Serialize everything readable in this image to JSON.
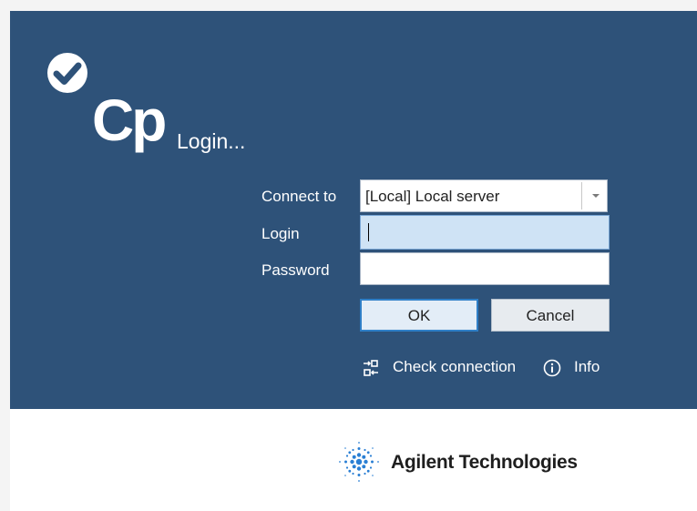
{
  "app": {
    "logo_text": "Cp",
    "title": "Login..."
  },
  "form": {
    "connect_to_label": "Connect to",
    "connect_to_value": "[Local] Local server",
    "login_label": "Login",
    "login_value": "",
    "password_label": "Password",
    "password_value": ""
  },
  "buttons": {
    "ok_label": "OK",
    "cancel_label": "Cancel"
  },
  "links": {
    "check_connection_label": "Check connection",
    "check_connection_icon": "connection-icon",
    "info_label": "Info",
    "info_icon": "info-icon"
  },
  "footer": {
    "brand_name": "Agilent Technologies",
    "brand_icon": "agilent-spark-logo"
  },
  "colors": {
    "header_background": "#2e5279",
    "login_field_focus": "#cfe3f5",
    "ok_button_border": "#2f7fc7",
    "agilent_blue": "#2a7fd4"
  }
}
